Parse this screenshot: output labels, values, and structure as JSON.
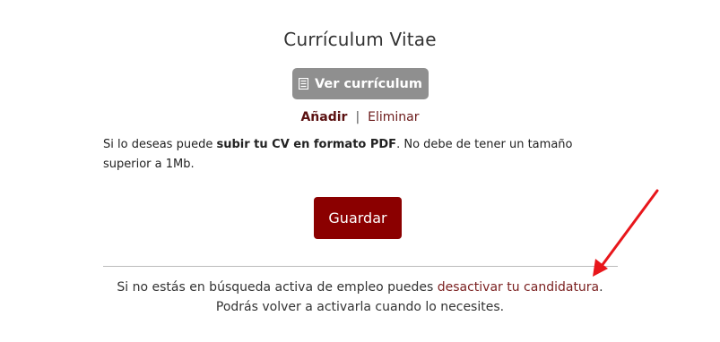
{
  "section": {
    "title": "Currículum Vitae"
  },
  "buttons": {
    "view_cv": "Ver currículum",
    "add": "Añadir",
    "separator": "|",
    "delete": "Eliminar",
    "save": "Guardar"
  },
  "info": {
    "prefix": "Si lo deseas puede ",
    "bold": "subir tu CV en formato PDF",
    "suffix": ". No debe de tener un tamaño superior a 1Mb."
  },
  "footer": {
    "line1_prefix": "Si no estás en búsqueda activa de empleo puedes ",
    "link": "desactivar tu candidatura",
    "line1_suffix": ".",
    "line2": "Podrás volver a activarla cuando lo necesites."
  },
  "colors": {
    "primary": "#8b0000",
    "secondary_button": "#8f8f8f",
    "link": "#7a1f1f",
    "annotation_arrow": "#e8161b"
  },
  "icons": {
    "view_cv": "document-icon",
    "annotation": "red-arrow-annotation"
  }
}
